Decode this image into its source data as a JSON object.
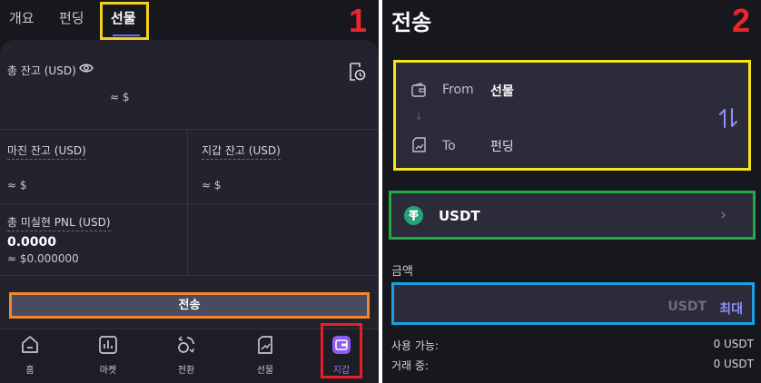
{
  "left": {
    "number_label": "1",
    "tabs": [
      {
        "label": "개요"
      },
      {
        "label": "펀딩"
      },
      {
        "label": "선물"
      }
    ],
    "total_balance": {
      "label": "총 잔고 (USD)",
      "value": "≈ $"
    },
    "margin_balance": {
      "label": "마진 잔고 (USD)",
      "value": "≈ $"
    },
    "wallet_balance": {
      "label": "지갑 잔고 (USD)",
      "value": "≈ $"
    },
    "unrealized_pnl": {
      "label": "총 미실현 PNL (USD)",
      "value": "0.0000",
      "sub_value": "≈ $0.000000"
    },
    "transfer_button": "전송",
    "nav": [
      {
        "label": "홈",
        "icon": "home-icon"
      },
      {
        "label": "마켓",
        "icon": "market-chart-icon"
      },
      {
        "label": "전환",
        "icon": "convert-icon"
      },
      {
        "label": "선물",
        "icon": "futures-icon"
      },
      {
        "label": "지갑",
        "icon": "wallet-icon"
      }
    ]
  },
  "right": {
    "number_label": "2",
    "title": "전송",
    "from_label": "From",
    "from_value": "선물",
    "to_label": "To",
    "to_value": "펀딩",
    "coin": "USDT",
    "amount_label": "금액",
    "amount_unit": "USDT",
    "max_label": "최대",
    "available_label": "사용 가능:",
    "available_value": "0 USDT",
    "in_trade_label": "거래 중:",
    "in_trade_value": "0 USDT"
  },
  "colors": {
    "background": "#17171e",
    "card": "#23232d",
    "accent": "#6b6ff0",
    "highlight_yellow": "#f5cf1f",
    "highlight_orange": "#f0882e",
    "highlight_red": "#e5202a",
    "highlight_green": "#21a947",
    "highlight_blue": "#1b9fe0",
    "tether": "#26a17b",
    "wallet_purple": "#8b5cf6"
  }
}
